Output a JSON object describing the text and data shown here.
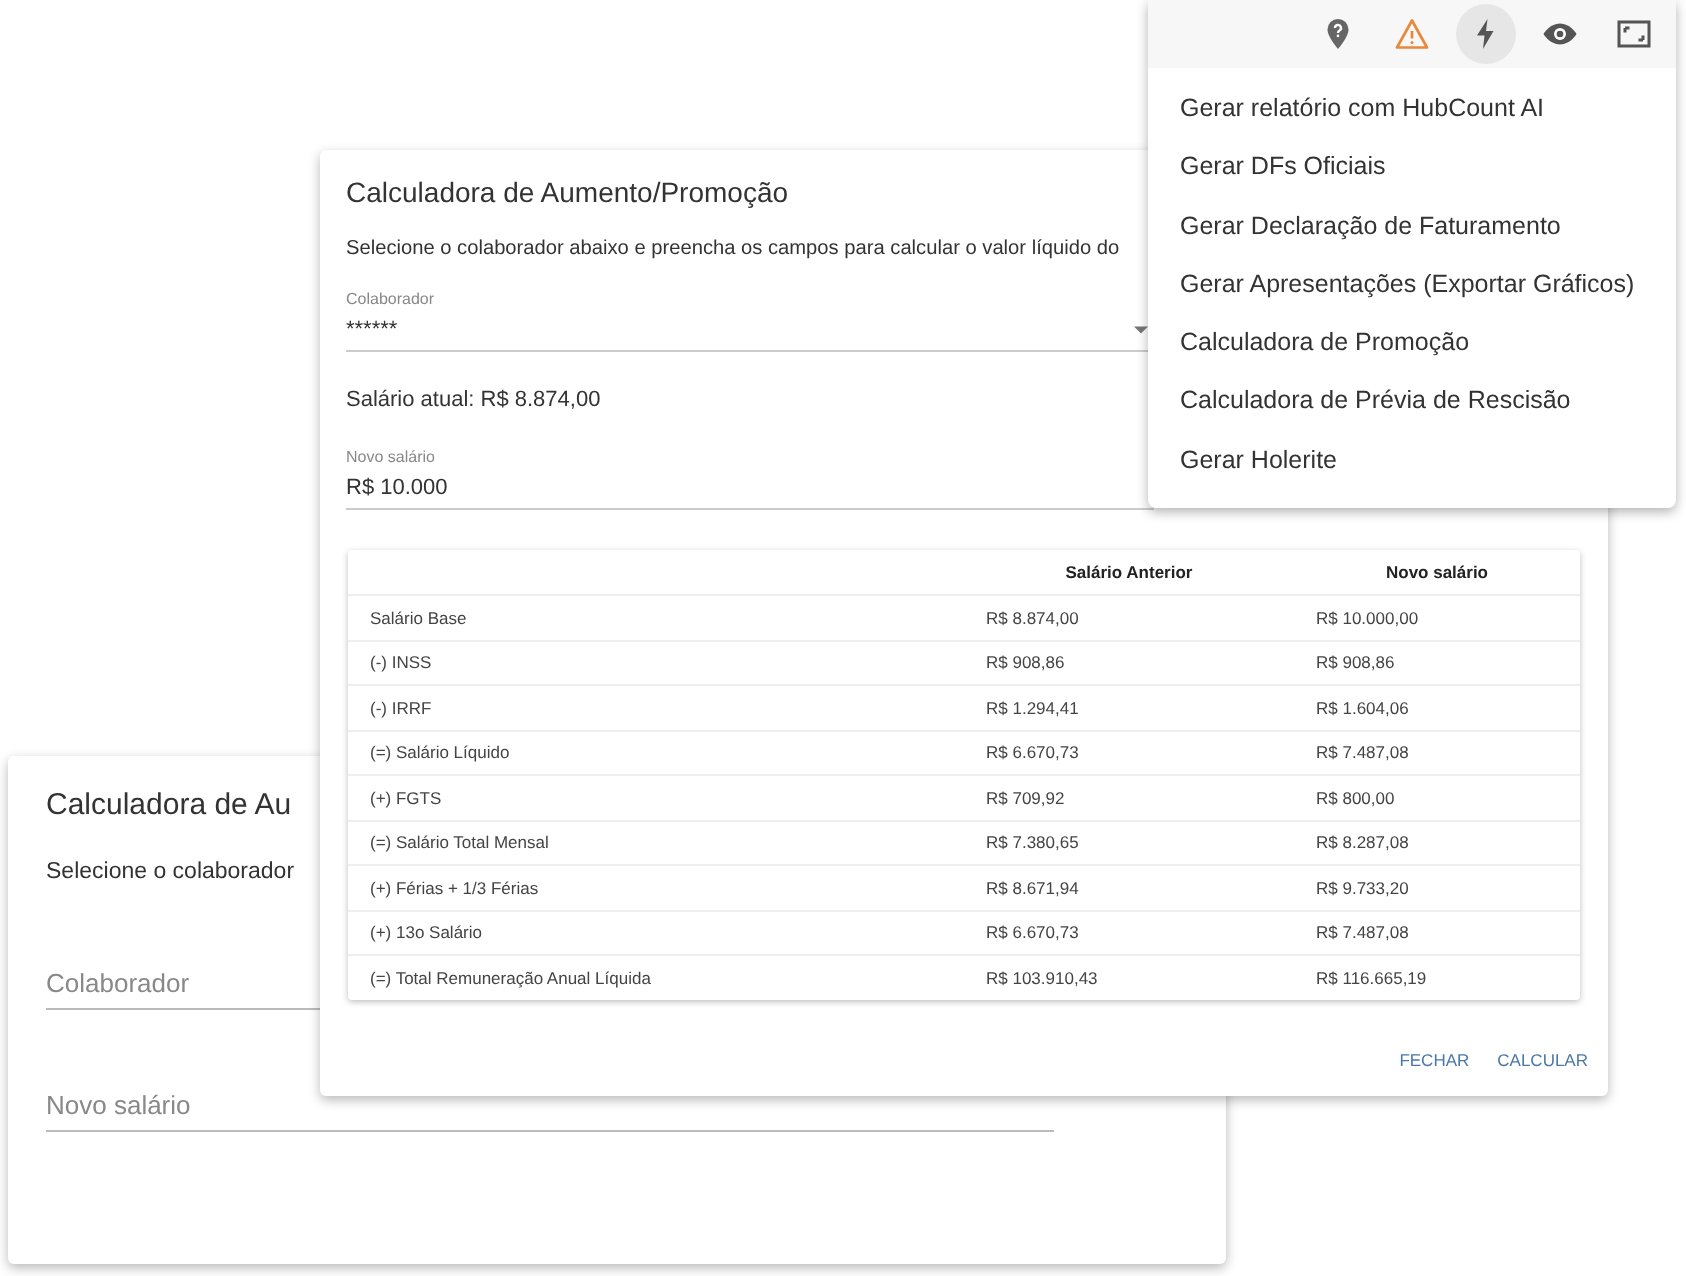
{
  "back_dialog": {
    "title": "Calculadora de Au",
    "description": "Selecione o colaborador",
    "fields": [
      {
        "placeholder": "Colaborador"
      },
      {
        "placeholder": "Novo salário"
      }
    ]
  },
  "dialog": {
    "title": "Calculadora de Aumento/Promoção",
    "description": "Selecione o colaborador abaixo e preencha os campos para calcular o valor líquido do",
    "employee_field": {
      "label": "Colaborador",
      "value": "******"
    },
    "current_salary": "Salário atual: R$ 8.874,00",
    "salary_field": {
      "label": "Novo salário",
      "value": "R$ 10.000"
    },
    "table": {
      "columns": [
        "Salário Anterior",
        "Novo salário"
      ],
      "rows": [
        {
          "label": "Salário Base",
          "previous": "R$ 8.874,00",
          "new": "R$ 10.000,00"
        },
        {
          "label": "(-) INSS",
          "previous": "R$ 908,86",
          "new": "R$ 908,86"
        },
        {
          "label": "(-) IRRF",
          "previous": "R$ 1.294,41",
          "new": "R$ 1.604,06"
        },
        {
          "label": "(=) Salário Líquido",
          "previous": "R$ 6.670,73",
          "new": "R$ 7.487,08"
        },
        {
          "label": "(+) FGTS",
          "previous": "R$ 709,92",
          "new": "R$ 800,00"
        },
        {
          "label": "(=) Salário Total Mensal",
          "previous": "R$ 7.380,65",
          "new": "R$ 8.287,08"
        },
        {
          "label": "(+) Férias + 1/3 Férias",
          "previous": "R$ 8.671,94",
          "new": "R$ 9.733,20"
        },
        {
          "label": "(+) 13o Salário",
          "previous": "R$ 6.670,73",
          "new": "R$ 7.487,08"
        },
        {
          "label": "(=) Total Remuneração Anual Líquida",
          "previous": "R$ 103.910,43",
          "new": "R$ 116.665,19"
        }
      ]
    },
    "buttons": [
      "FECHAR",
      "CALCULAR"
    ]
  },
  "toolbar": [
    {
      "kind": "pin",
      "selected": false
    },
    {
      "kind": "warning",
      "selected": false
    },
    {
      "kind": "bolt",
      "selected": true
    },
    {
      "kind": "eye",
      "selected": false
    },
    {
      "kind": "fullscreen",
      "selected": false
    }
  ],
  "menu": {
    "items": [
      "Gerar relatório com HubCount AI",
      "Gerar DFs Oficiais",
      "Gerar Declaração de Faturamento",
      "Gerar Apresentações (Exportar Gráficos)",
      "Calculadora de Promoção",
      "Calculadora de Prévia de Rescisão",
      "Gerar Holerite"
    ]
  }
}
